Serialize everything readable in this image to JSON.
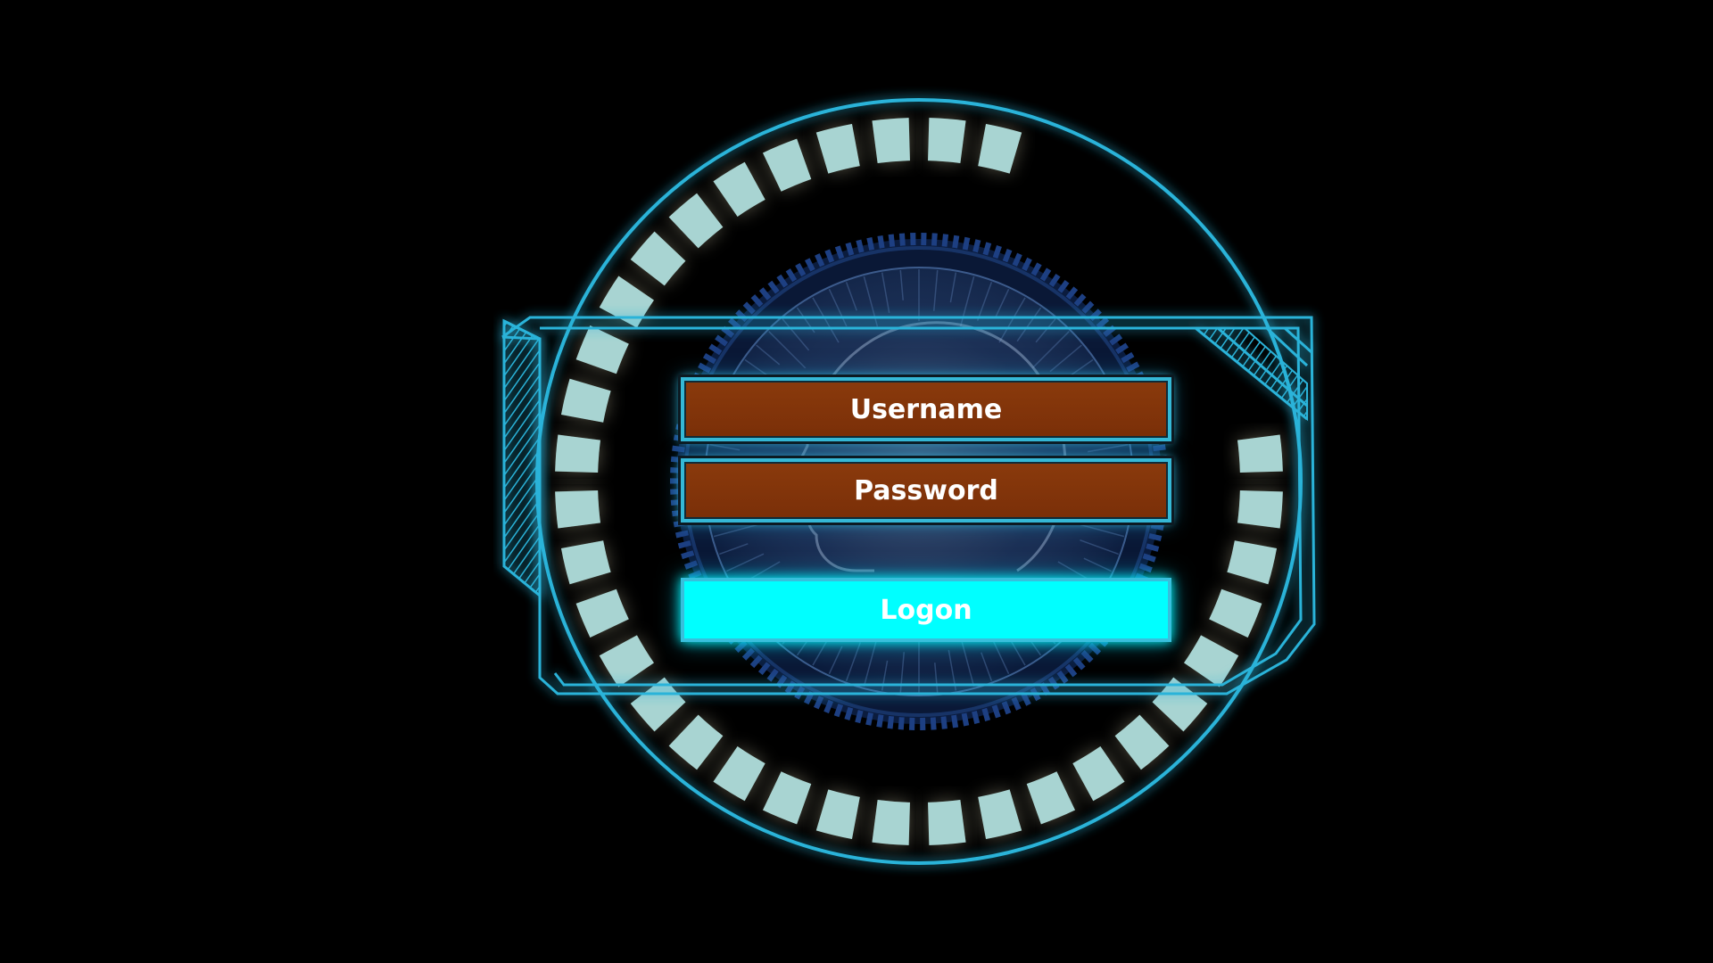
{
  "login": {
    "username_label": "Username",
    "password_label": "Password",
    "logon_label": "Logon"
  },
  "theme": {
    "background": "#000000",
    "frame_cyan": "#2bb3d9",
    "tile_color": "#a8d4d2",
    "tile_glow": "#e8e2bd",
    "field_fill": "#7a2f08",
    "button_fill": "#00ffff",
    "core_blue": "#1c3f7a"
  },
  "icons": {
    "face_silhouette": "face-silhouette-icon"
  }
}
